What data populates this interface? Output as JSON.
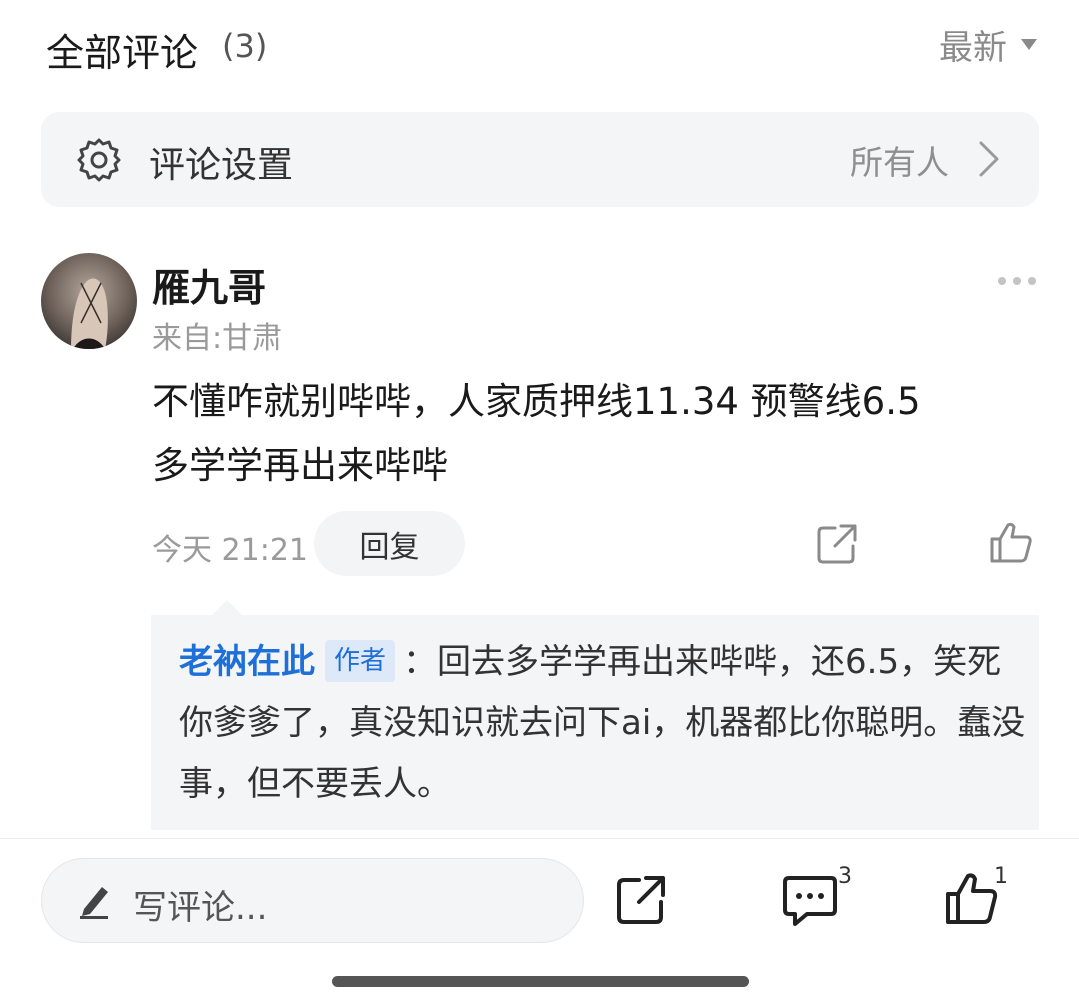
{
  "header": {
    "title": "全部评论",
    "count": "(3)",
    "sort_label": "最新"
  },
  "settings": {
    "label": "评论设置",
    "value": "所有人",
    "icon": "gear-icon"
  },
  "comment": {
    "username": "雁九哥",
    "location": "来自:甘肃",
    "text": "不懂咋就别哔哔，人家质押线11.34  预警线6.5\n多学学再出来哔哔",
    "time": "今天 21:21",
    "reply_label": "回复"
  },
  "reply": {
    "author": "老衲在此",
    "badge": "作者",
    "text": "：回去多学学再出来哔哔，还6.5，笑死你爹爹了，真没知识就去问下ai，机器都比你聪明。蠢没事，但不要丢人。"
  },
  "bottom_bar": {
    "placeholder": "写评论...",
    "comment_count": "3",
    "like_count": "1"
  },
  "colors": {
    "accent": "#1e6fd8",
    "badge_bg": "#dde9f8",
    "panel_bg": "#f4f5f7",
    "muted_text": "#9a9a9a"
  }
}
